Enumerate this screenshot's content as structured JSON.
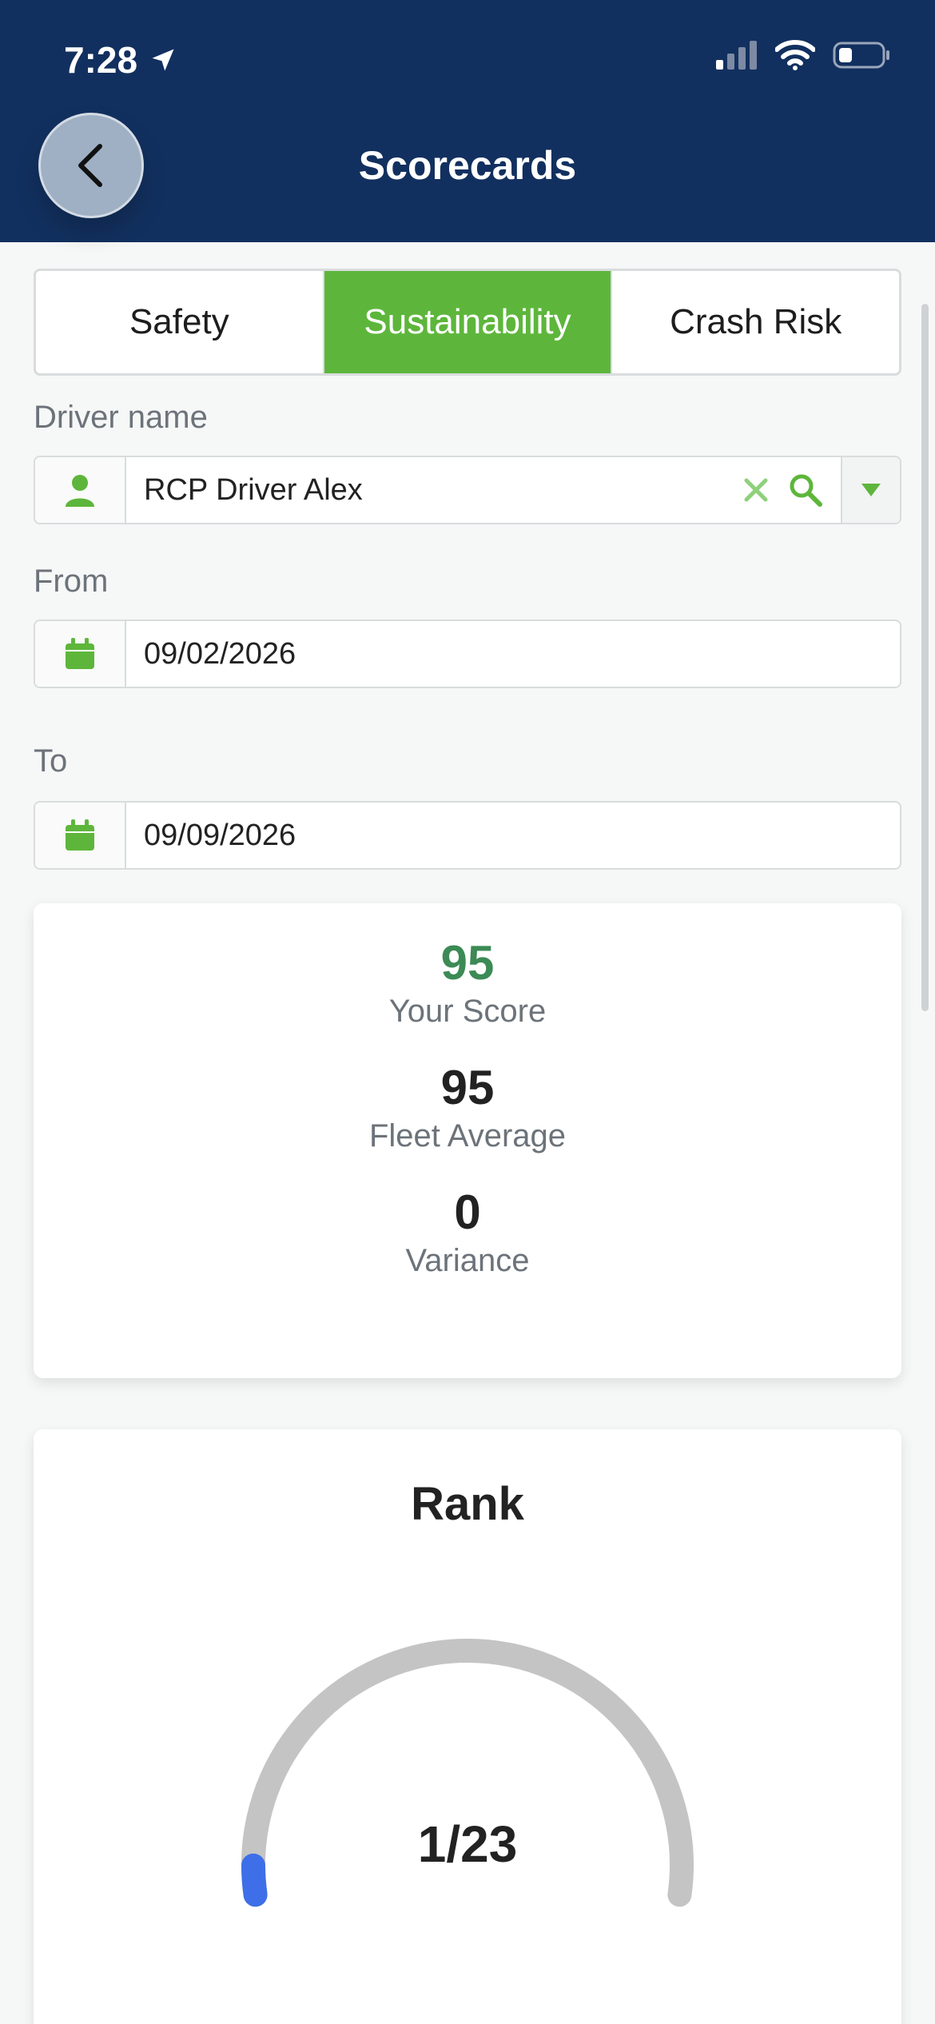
{
  "status_bar": {
    "time": "7:28"
  },
  "header": {
    "title": "Scorecards"
  },
  "tabs": [
    {
      "label": "Safety",
      "active": false
    },
    {
      "label": "Sustainability",
      "active": true
    },
    {
      "label": "Crash Risk",
      "active": false
    }
  ],
  "driver": {
    "label": "Driver name",
    "value": "RCP Driver Alex"
  },
  "from": {
    "label": "From",
    "value": "09/02/2026"
  },
  "to": {
    "label": "To",
    "value": "09/09/2026"
  },
  "scores": {
    "your_score": {
      "value": "95",
      "label": "Your Score"
    },
    "fleet_average": {
      "value": "95",
      "label": "Fleet Average"
    },
    "variance": {
      "value": "0",
      "label": "Variance"
    }
  },
  "rank": {
    "title": "Rank",
    "value": "1/23",
    "position": 1,
    "total": 23
  },
  "colors": {
    "header": "#12305f",
    "accent_green": "#5db63b",
    "score_green": "#3c8a55",
    "gauge_track": "#c4c4c4",
    "gauge_fill": "#3e6fe8"
  }
}
